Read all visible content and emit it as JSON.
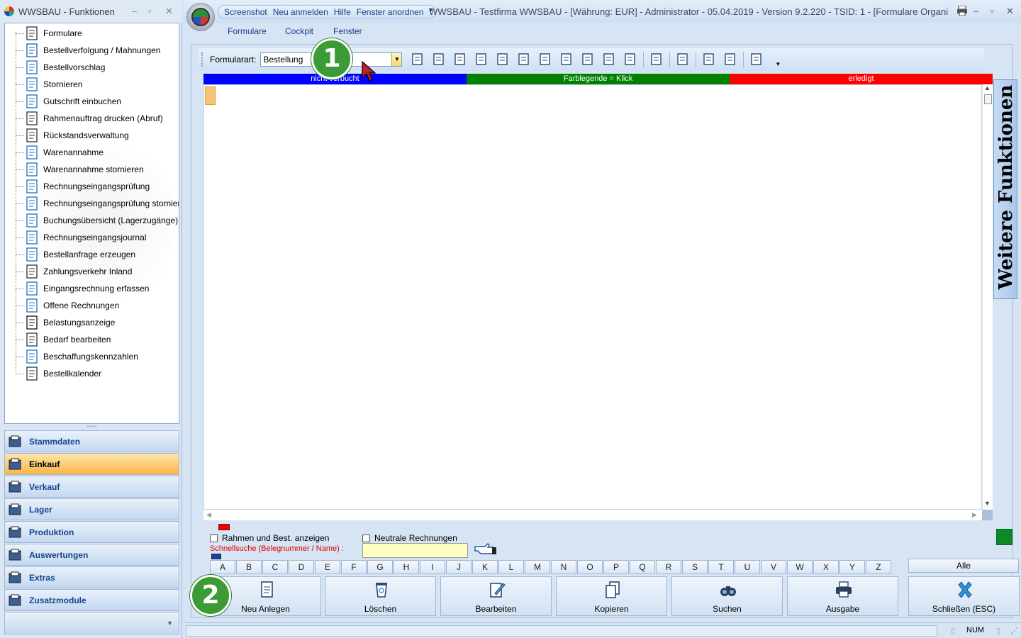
{
  "left_window": {
    "title": "WWSBAU - Funktionen",
    "tree_items": [
      {
        "label": "Formulare",
        "icon": "document-icon"
      },
      {
        "label": "Bestellverfolgung / Mahnungen",
        "icon": "map-icon"
      },
      {
        "label": "Bestellvorschlag",
        "icon": "cart-icon"
      },
      {
        "label": "Stornieren",
        "icon": "cart-cancel-icon"
      },
      {
        "label": "Gutschrift einbuchen",
        "icon": "credit-icon"
      },
      {
        "label": "Rahmenauftrag drucken (Abruf)",
        "icon": "print-document-icon"
      },
      {
        "label": "Rückstandsverwaltung",
        "icon": "clock-icon"
      },
      {
        "label": "Warenannahme",
        "icon": "handtruck-icon"
      },
      {
        "label": "Warenannahme stornieren",
        "icon": "handtruck-cancel-icon"
      },
      {
        "label": "Rechnungseingangsprüfung",
        "icon": "euro-document-icon"
      },
      {
        "label": "Rechnungseingangsprüfung stornieren",
        "icon": "euro-cancel-icon"
      },
      {
        "label": "Buchungsübersicht (Lagerzugänge)",
        "icon": "ledger-icon"
      },
      {
        "label": "Rechnungseingangsjournal",
        "icon": "journal-icon"
      },
      {
        "label": "Bestellanfrage erzeugen",
        "icon": "cart-document-icon"
      },
      {
        "label": "Zahlungsverkehr Inland",
        "icon": "payment-icon"
      },
      {
        "label": "Eingangsrechnung erfassen",
        "icon": "euro-document-icon"
      },
      {
        "label": "Offene Rechnungen",
        "icon": "euro-document-icon"
      },
      {
        "label": "Belastungsanzeige",
        "icon": "weight-icon"
      },
      {
        "label": "Bedarf bearbeiten",
        "icon": "basket-icon"
      },
      {
        "label": "Beschaffungskennzahlen",
        "icon": "calendar-info-icon"
      },
      {
        "label": "Bestellkalender",
        "icon": "calendar-icon"
      }
    ],
    "nav_buttons": [
      {
        "label": "Stammdaten",
        "icon": "stammdaten-icon",
        "active": false
      },
      {
        "label": "Einkauf",
        "icon": "cart-icon",
        "active": true
      },
      {
        "label": "Verkauf",
        "icon": "cash-register-icon",
        "active": false
      },
      {
        "label": "Lager",
        "icon": "warehouse-icon",
        "active": false
      },
      {
        "label": "Produktion",
        "icon": "production-icon",
        "active": false
      },
      {
        "label": "Auswertungen",
        "icon": "chart-icon",
        "active": false
      },
      {
        "label": "Extras",
        "icon": "extras-icon",
        "active": false
      },
      {
        "label": "Zusatzmodule",
        "icon": "modules-icon",
        "active": false
      }
    ]
  },
  "main_window": {
    "quick_access": [
      "Screenshot",
      "Neu anmelden",
      "Hilfe",
      "Fenster anordnen"
    ],
    "title": "WWSBAU - Testfirma WWSBAU - [Währung: EUR] - Administrator - 05.04.2019 - Version 9.2.220 - TSID: 1  - [Formulare Organi",
    "ribbon_tabs": [
      "Formulare",
      "Cockpit",
      "Fenster"
    ],
    "toolbar": {
      "formtype_label": "Formularart:",
      "formtype_value": "Bestellung"
    },
    "legend": [
      {
        "label": "nicht verbucht",
        "color": "#0000ff"
      },
      {
        "label": "Farblegende = Klick",
        "color": "#008000"
      },
      {
        "label": "erledigt",
        "color": "#ff0000"
      }
    ],
    "side_tab": "Weitere Funktionen",
    "filters": {
      "show_frames_label": "Rahmen und Best. anzeigen",
      "neutral_invoices_label": "Neutrale Rechnungen",
      "quicksearch_label": "Schnellsuche (Belegnummer / Name) :",
      "quicksearch_value": ""
    },
    "alphabet": [
      "A",
      "B",
      "C",
      "D",
      "E",
      "F",
      "G",
      "H",
      "I",
      "J",
      "K",
      "L",
      "M",
      "N",
      "O",
      "P",
      "Q",
      "R",
      "S",
      "T",
      "U",
      "V",
      "W",
      "X",
      "Y",
      "Z"
    ],
    "alle_label": "Alle",
    "actions": [
      {
        "label": "Neu Anlegen",
        "icon": "new-document-icon"
      },
      {
        "label": "Löschen",
        "icon": "recycle-bin-icon"
      },
      {
        "label": "Bearbeiten",
        "icon": "edit-document-icon"
      },
      {
        "label": "Kopieren",
        "icon": "copy-document-icon"
      },
      {
        "label": "Suchen",
        "icon": "binoculars-icon"
      },
      {
        "label": "Ausgabe",
        "icon": "printer-icon"
      },
      {
        "label": "Schließen (ESC)",
        "icon": "close-x-icon"
      }
    ],
    "status": {
      "num": "NUM"
    }
  },
  "callouts": [
    "1",
    "2"
  ]
}
